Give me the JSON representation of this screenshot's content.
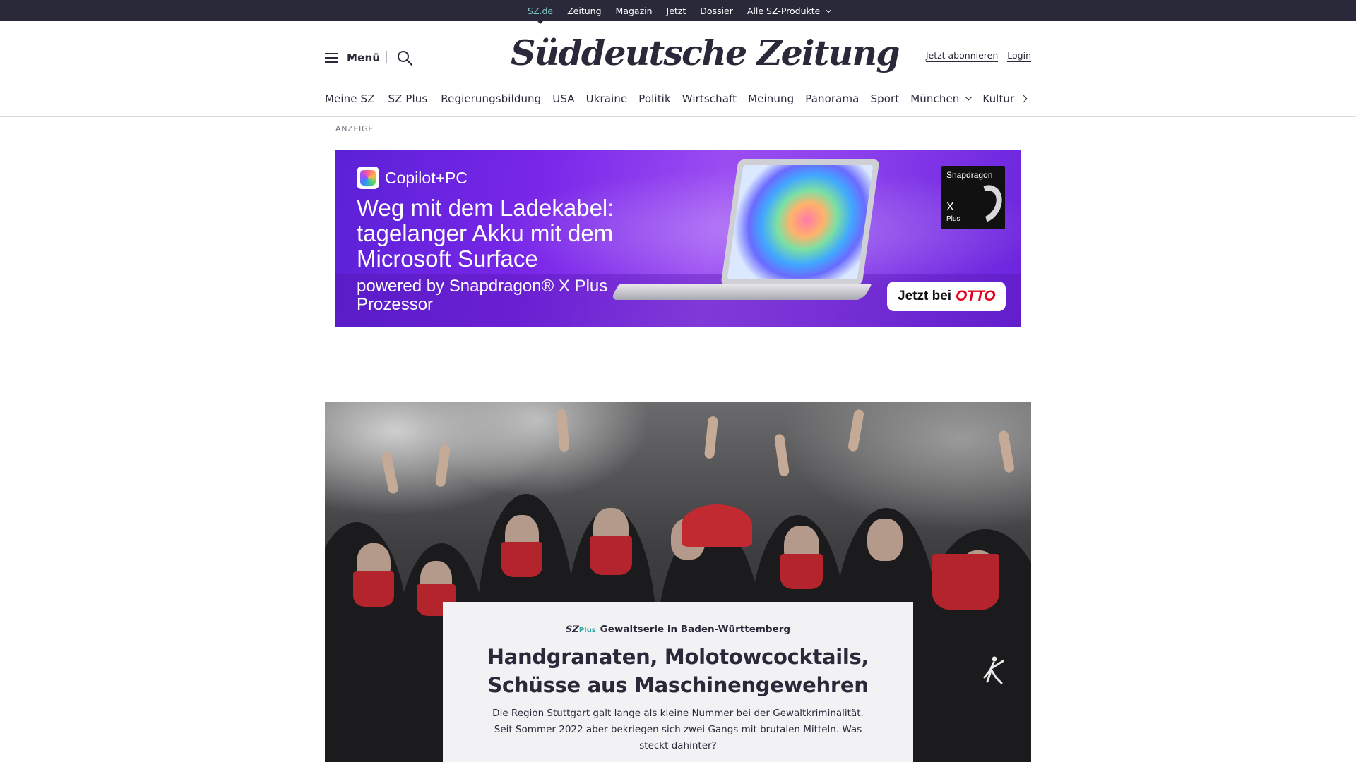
{
  "topbar": {
    "items": [
      {
        "label": "SZ.de",
        "active": true
      },
      {
        "label": "Zeitung"
      },
      {
        "label": "Magazin"
      },
      {
        "label": "Jetzt"
      },
      {
        "label": "Dossier"
      },
      {
        "label": "Alle SZ-Produkte",
        "has_dropdown": true
      }
    ]
  },
  "masthead": {
    "menu_label": "Menü",
    "logo_text": "Süddeutsche Zeitung",
    "subscribe_label": "Jetzt abonnieren",
    "login_label": "Login"
  },
  "section_nav": {
    "items": [
      {
        "label": "Meine SZ"
      },
      {
        "label": "SZ Plus"
      },
      {
        "label": "Regierungsbildung"
      },
      {
        "label": "USA"
      },
      {
        "label": "Ukraine"
      },
      {
        "label": "Politik"
      },
      {
        "label": "Wirtschaft"
      },
      {
        "label": "Meinung"
      },
      {
        "label": "Panorama"
      },
      {
        "label": "Sport"
      },
      {
        "label": "München",
        "has_dropdown": true
      },
      {
        "label": "Kultur"
      }
    ]
  },
  "ad": {
    "label": "ANZEIGE",
    "brand": "Copilot+PC",
    "headline": "Weg mit dem Ladekabel: tagelanger Akku mit dem Microsoft Surface",
    "sub": "powered by Snapdragon® X Plus Prozessor",
    "badge_title": "Snapdragon",
    "badge_x": "X",
    "badge_plus": "Plus",
    "cta_prefix": "Jetzt bei",
    "cta_brand": "OTTO"
  },
  "hero": {
    "badge_sz": "SZ",
    "badge_plus": "Plus",
    "kicker": "Gewaltserie in Baden-Württemberg",
    "headline": "Handgranaten, Molotowcocktails, Schüsse aus Maschinengewehren",
    "teaser": "Die Region Stuttgart galt lange als kleine Nummer bei der Gewaltkriminalität. Seit Sommer 2022 aber bekriegen sich zwei Gangs mit brutalen Mitteln. Was steckt dahinter?"
  },
  "colors": {
    "topbar_bg": "#29293a",
    "active_link": "#7bc7c3",
    "text": "#29293a",
    "sz_plus_accent": "#2aa3a0",
    "otto_red": "#e3001b"
  }
}
